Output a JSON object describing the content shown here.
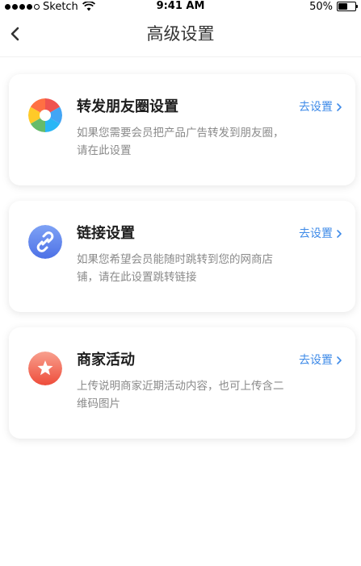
{
  "status_bar": {
    "carrier": "Sketch",
    "time": "9:41 AM",
    "battery": "50%",
    "battery_level": 0.5
  },
  "nav": {
    "title": "高级设置",
    "back_icon": "chevron-left-icon"
  },
  "settings": [
    {
      "title": "转发朋友圈设置",
      "description": "如果您需要会员把产品广告转发到朋友圈，请在此设置",
      "action": "去设置",
      "icon": "aperture-icon"
    },
    {
      "title": "链接设置",
      "description": "如果您希望会员能随时跳转到您的网商店铺，请在此设置跳转链接",
      "action": "去设置",
      "icon": "link-icon",
      "color": "#5b7fef"
    },
    {
      "title": "商家活动",
      "description": "上传说明商家近期活动内容，也可上传含二维码图片",
      "action": "去设置",
      "icon": "star-icon",
      "color": "#f1614f"
    }
  ]
}
